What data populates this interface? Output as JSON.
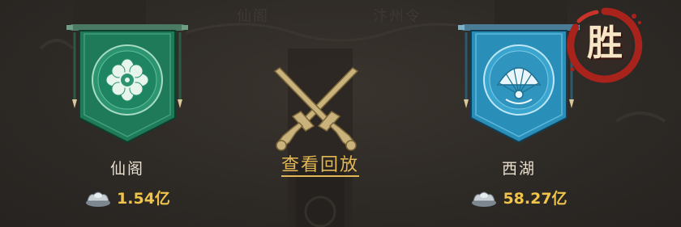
{
  "header": {
    "left_faint": "仙阁",
    "right_faint": "汴州令"
  },
  "match": {
    "left": {
      "guild_name": "仙阁",
      "power": "1.54亿",
      "emblem_icon": "flower-emblem-icon",
      "banner_color": "#1f7a5a"
    },
    "right": {
      "guild_name": "西湖",
      "power": "58.27亿",
      "emblem_icon": "fan-emblem-icon",
      "banner_color": "#2a8fb8",
      "result": "胜"
    },
    "replay_label": "查看回放",
    "center_icon": "crossed-swords-icon"
  },
  "colors": {
    "power_text": "#f0c44a",
    "replay_text": "#e2b754",
    "win_ring": "#a8231c"
  }
}
